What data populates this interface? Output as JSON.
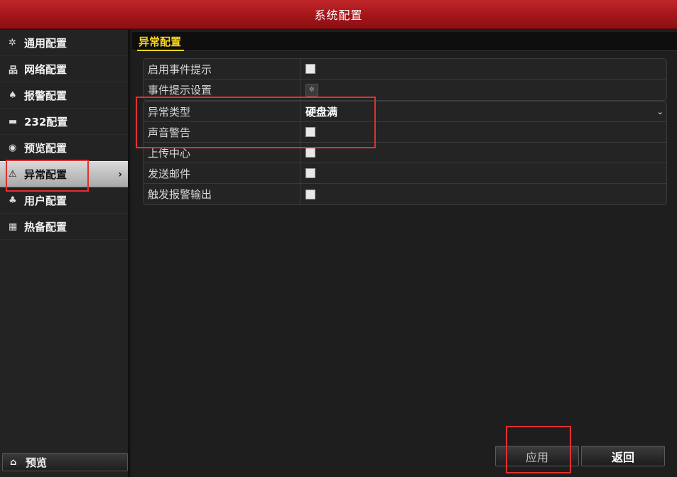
{
  "window": {
    "title": "系统配置"
  },
  "sidebar": {
    "items": [
      {
        "label": "通用配置",
        "icon": "gear-icon",
        "glyph": "✲"
      },
      {
        "label": "网络配置",
        "icon": "network-icon",
        "glyph": "品"
      },
      {
        "label": "报警配置",
        "icon": "alarm-icon",
        "glyph": "♠"
      },
      {
        "label": "232配置",
        "icon": "serial-port-icon",
        "glyph": "▬"
      },
      {
        "label": "预览配置",
        "icon": "eye-icon",
        "glyph": "◉"
      },
      {
        "label": "异常配置",
        "icon": "warning-icon",
        "glyph": "⚠",
        "active": true
      },
      {
        "label": "用户配置",
        "icon": "users-icon",
        "glyph": "♣"
      },
      {
        "label": "热备配置",
        "icon": "hot-backup-icon",
        "glyph": "▦"
      }
    ],
    "chevron": "›",
    "bottom_button": {
      "label": "预览",
      "icon": "home-icon",
      "glyph": "⌂"
    }
  },
  "main": {
    "tab": "异常配置",
    "rows_group1": [
      {
        "label": "启用事件提示",
        "control": "checkbox",
        "checked": false
      },
      {
        "label": "事件提示设置",
        "control": "gear-button"
      }
    ],
    "rows_group2": [
      {
        "label": "异常类型",
        "control": "select",
        "value": "硬盘满"
      },
      {
        "label": "声音警告",
        "control": "checkbox",
        "checked": false
      },
      {
        "label": "上传中心",
        "control": "checkbox",
        "checked": false
      },
      {
        "label": "发送邮件",
        "control": "checkbox",
        "checked": false
      },
      {
        "label": "触发报警输出",
        "control": "checkbox",
        "checked": false
      }
    ],
    "select_arrow": "⌄",
    "gear_glyph": "✲"
  },
  "footer": {
    "apply_label": "应用",
    "back_label": "返回"
  },
  "colors": {
    "titlebar": "#a3161a",
    "tab_accent": "#f5d21b",
    "highlight_box": "#e2302f"
  }
}
